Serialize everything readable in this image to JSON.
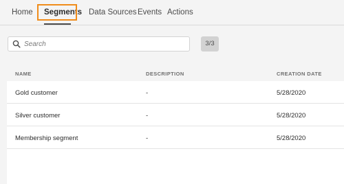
{
  "nav": {
    "tabs": [
      {
        "label": "Home"
      },
      {
        "label": "Segments"
      },
      {
        "label": "Data Sources"
      },
      {
        "label": "Events"
      },
      {
        "label": "Actions"
      }
    ],
    "active_tab": "Segments"
  },
  "search": {
    "placeholder": "Search",
    "value": ""
  },
  "count_badge": "3/3",
  "table": {
    "columns": [
      "NAME",
      "DESCRIPTION",
      "CREATION DATE"
    ],
    "rows": [
      [
        "Gold customer",
        "-",
        "5/28/2020"
      ],
      [
        "Silver customer",
        "-",
        "5/28/2020"
      ],
      [
        "Membership segment",
        "-",
        "5/28/2020"
      ]
    ]
  },
  "colors": {
    "highlight": "#f08c1a",
    "background": "#f4f4f4",
    "badge": "#d2d2d2"
  },
  "icons": {
    "search": "search-icon"
  }
}
